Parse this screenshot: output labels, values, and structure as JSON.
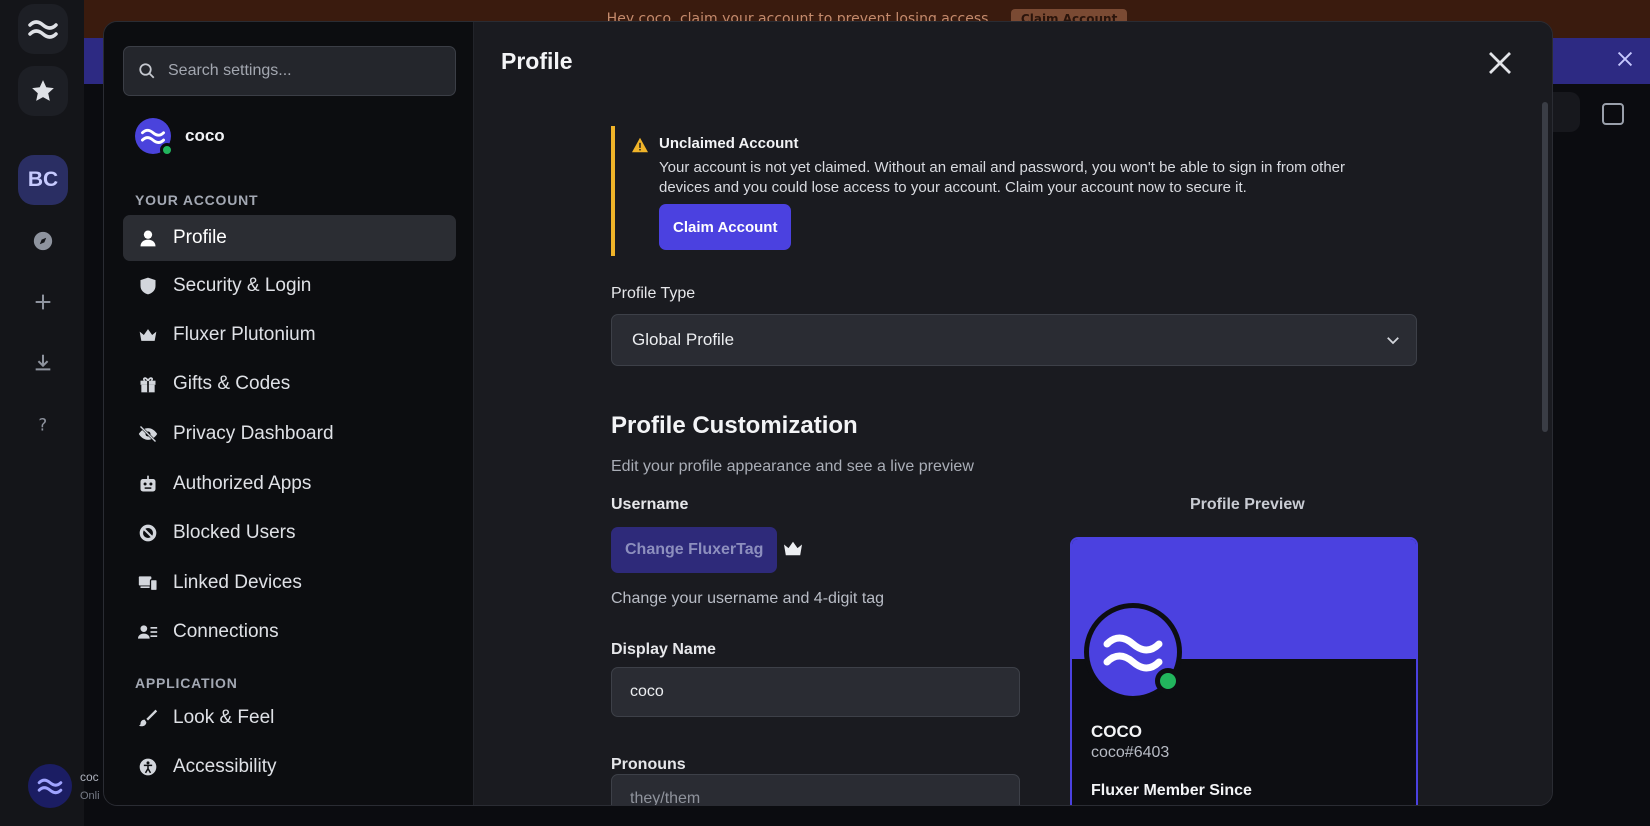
{
  "background": {
    "banner_text": "Hey coco, claim your account to prevent losing access.",
    "banner_button": "Claim Account",
    "server_initials": "BC",
    "user_name": "coc",
    "user_status": "Onli"
  },
  "search": {
    "placeholder": "Search settings..."
  },
  "user": {
    "name": "coco"
  },
  "sidebar": {
    "account_header": "YOUR ACCOUNT",
    "app_header": "APPLICATION",
    "account_items": [
      {
        "label": "Profile",
        "icon": "person-icon"
      },
      {
        "label": "Security & Login",
        "icon": "shield-icon"
      },
      {
        "label": "Fluxer Plutonium",
        "icon": "crown-icon"
      },
      {
        "label": "Gifts & Codes",
        "icon": "gift-icon"
      },
      {
        "label": "Privacy Dashboard",
        "icon": "eye-slash-icon"
      },
      {
        "label": "Authorized Apps",
        "icon": "robot-icon"
      },
      {
        "label": "Blocked Users",
        "icon": "blocked-icon"
      },
      {
        "label": "Linked Devices",
        "icon": "devices-icon"
      },
      {
        "label": "Connections",
        "icon": "connections-icon"
      }
    ],
    "app_items": [
      {
        "label": "Look & Feel",
        "icon": "brush-icon"
      },
      {
        "label": "Accessibility",
        "icon": "accessibility-icon"
      }
    ]
  },
  "main": {
    "title": "Profile",
    "warning": {
      "title": "Unclaimed Account",
      "text": "Your account is not yet claimed. Without an email and password, you won't be able to sign in from other devices and you could lose access to your account. Claim your account now to secure it.",
      "button": "Claim Account"
    },
    "profile_type": {
      "label": "Profile Type",
      "value": "Global Profile"
    },
    "customization": {
      "title": "Profile Customization",
      "subtitle": "Edit your profile appearance and see a live preview"
    },
    "username": {
      "label": "Username",
      "button": "Change FluxerTag",
      "hint": "Change your username and 4-digit tag"
    },
    "display_name": {
      "label": "Display Name",
      "value": "coco"
    },
    "pronouns": {
      "label": "Pronouns",
      "placeholder": "they/them"
    },
    "preview": {
      "label": "Profile Preview",
      "name": "COCO",
      "tag": "coco#6403",
      "member_since": "Fluxer Member Since"
    }
  },
  "colors": {
    "accent": "#4b41e0",
    "online": "#22b55d",
    "warning": "#f0b429"
  }
}
